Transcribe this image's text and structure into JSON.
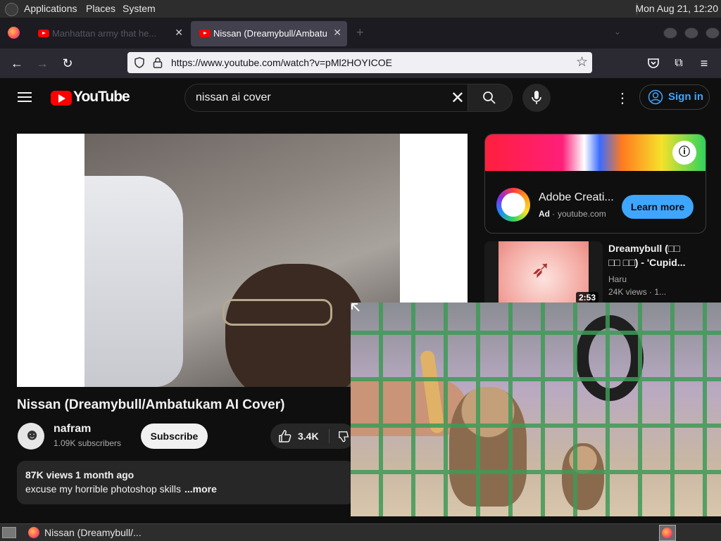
{
  "desktop": {
    "menus": [
      "Applications",
      "Places",
      "System"
    ],
    "clock": "Mon Aug 21, 12:20"
  },
  "browser": {
    "tabs": [
      {
        "title": "Manhattan army that he...",
        "active": false
      },
      {
        "title": "Nissan (Dreamybull/Ambatu",
        "active": true
      }
    ],
    "url": "https://www.youtube.com/watch?v=pMl2HOYICOE"
  },
  "youtube": {
    "logo": "YouTube",
    "search_value": "nissan ai cover",
    "signin_label": "Sign in",
    "video": {
      "title": "Nissan (Dreamybull/Ambatukam AI Cover)",
      "channel": "nafram",
      "subscribers": "1.09K subscribers",
      "subscribe_label": "Subscribe",
      "likes": "3.4K",
      "views": "87K views",
      "date": "1 month ago",
      "description": "excuse my horrible photoshop skills",
      "more": "...more"
    },
    "ad": {
      "title": "Adobe Creati...",
      "label": "Ad",
      "domain": "youtube.com",
      "button": "Learn more"
    },
    "recommendation": {
      "title_line1": "Dreamybull (□□",
      "title_line2": "□□ □□) - 'Cupid...",
      "channel": "Haru",
      "meta": "24K views · 1...",
      "duration": "2:53"
    }
  },
  "taskbar": {
    "window_title": "Nissan (Dreamybull/..."
  },
  "colors": {
    "accent_blue": "#3ea6ff",
    "yt_red": "#ff0000",
    "bg": "#0f0f0f"
  }
}
